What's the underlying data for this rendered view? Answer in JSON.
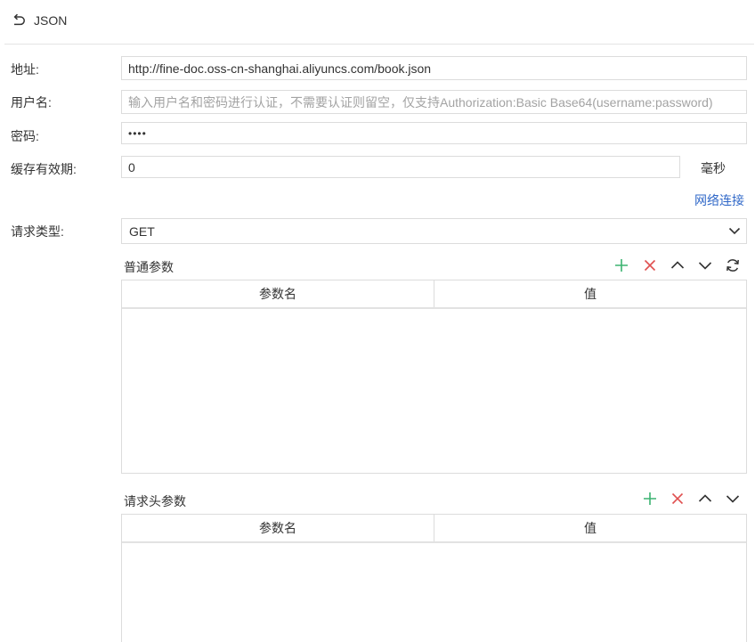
{
  "header": {
    "title": "JSON"
  },
  "form": {
    "address_label": "地址:",
    "address_value": "http://fine-doc.oss-cn-shanghai.aliyuncs.com/book.json",
    "username_label": "用户名:",
    "username_placeholder": "输入用户名和密码进行认证，不需要认证则留空，仅支持Authorization:Basic Base64(username:password)",
    "password_label": "密码:",
    "password_value": "••••",
    "cache_label": "缓存有效期:",
    "cache_value": "0",
    "cache_unit": "毫秒",
    "network_link": "网络连接",
    "request_type_label": "请求类型:",
    "request_type_value": "GET"
  },
  "params": {
    "title": "普通参数",
    "columns": [
      "参数名",
      "值"
    ],
    "rows": []
  },
  "headers": {
    "title": "请求头参数",
    "columns": [
      "参数名",
      "值"
    ],
    "rows": []
  },
  "colors": {
    "add": "#3cb371",
    "delete": "#e05050",
    "link": "#3068c8"
  }
}
